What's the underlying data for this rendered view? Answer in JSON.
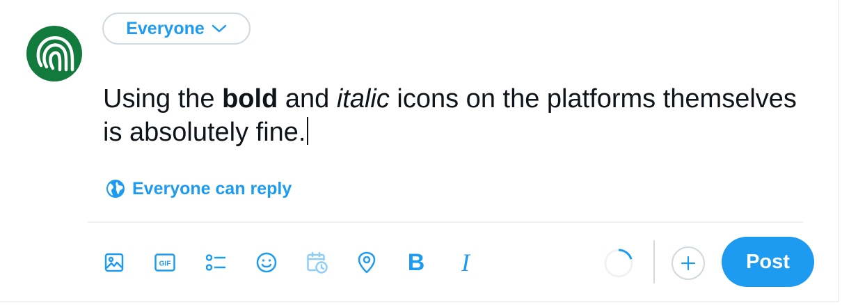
{
  "colors": {
    "accent": "#1d9bf0",
    "text": "#0f1419",
    "border": "#cfd9de",
    "divider": "#eff3f4",
    "avatar_bg": "#137a3d"
  },
  "audience": {
    "label": "Everyone",
    "icon": "chevron-down-icon"
  },
  "composer": {
    "segments": [
      {
        "text": "Using the ",
        "style": "normal"
      },
      {
        "text": "bold",
        "style": "bold"
      },
      {
        "text": " and ",
        "style": "normal"
      },
      {
        "text": "italic",
        "style": "italic"
      },
      {
        "text": " icons on the platforms themselves is absolutely fine.",
        "style": "normal"
      }
    ]
  },
  "reply_setting": {
    "label": "Everyone can reply",
    "icon": "globe-icon"
  },
  "toolbar": {
    "icons": [
      "image-icon",
      "gif-icon",
      "poll-icon",
      "emoji-icon",
      "schedule-icon",
      "location-icon",
      "bold-icon",
      "italic-icon"
    ],
    "gif_label": "GIF",
    "bold_label": "B",
    "italic_label": "I",
    "char_progress": 0.2,
    "add_icon": "plus-icon",
    "post_label": "Post"
  }
}
